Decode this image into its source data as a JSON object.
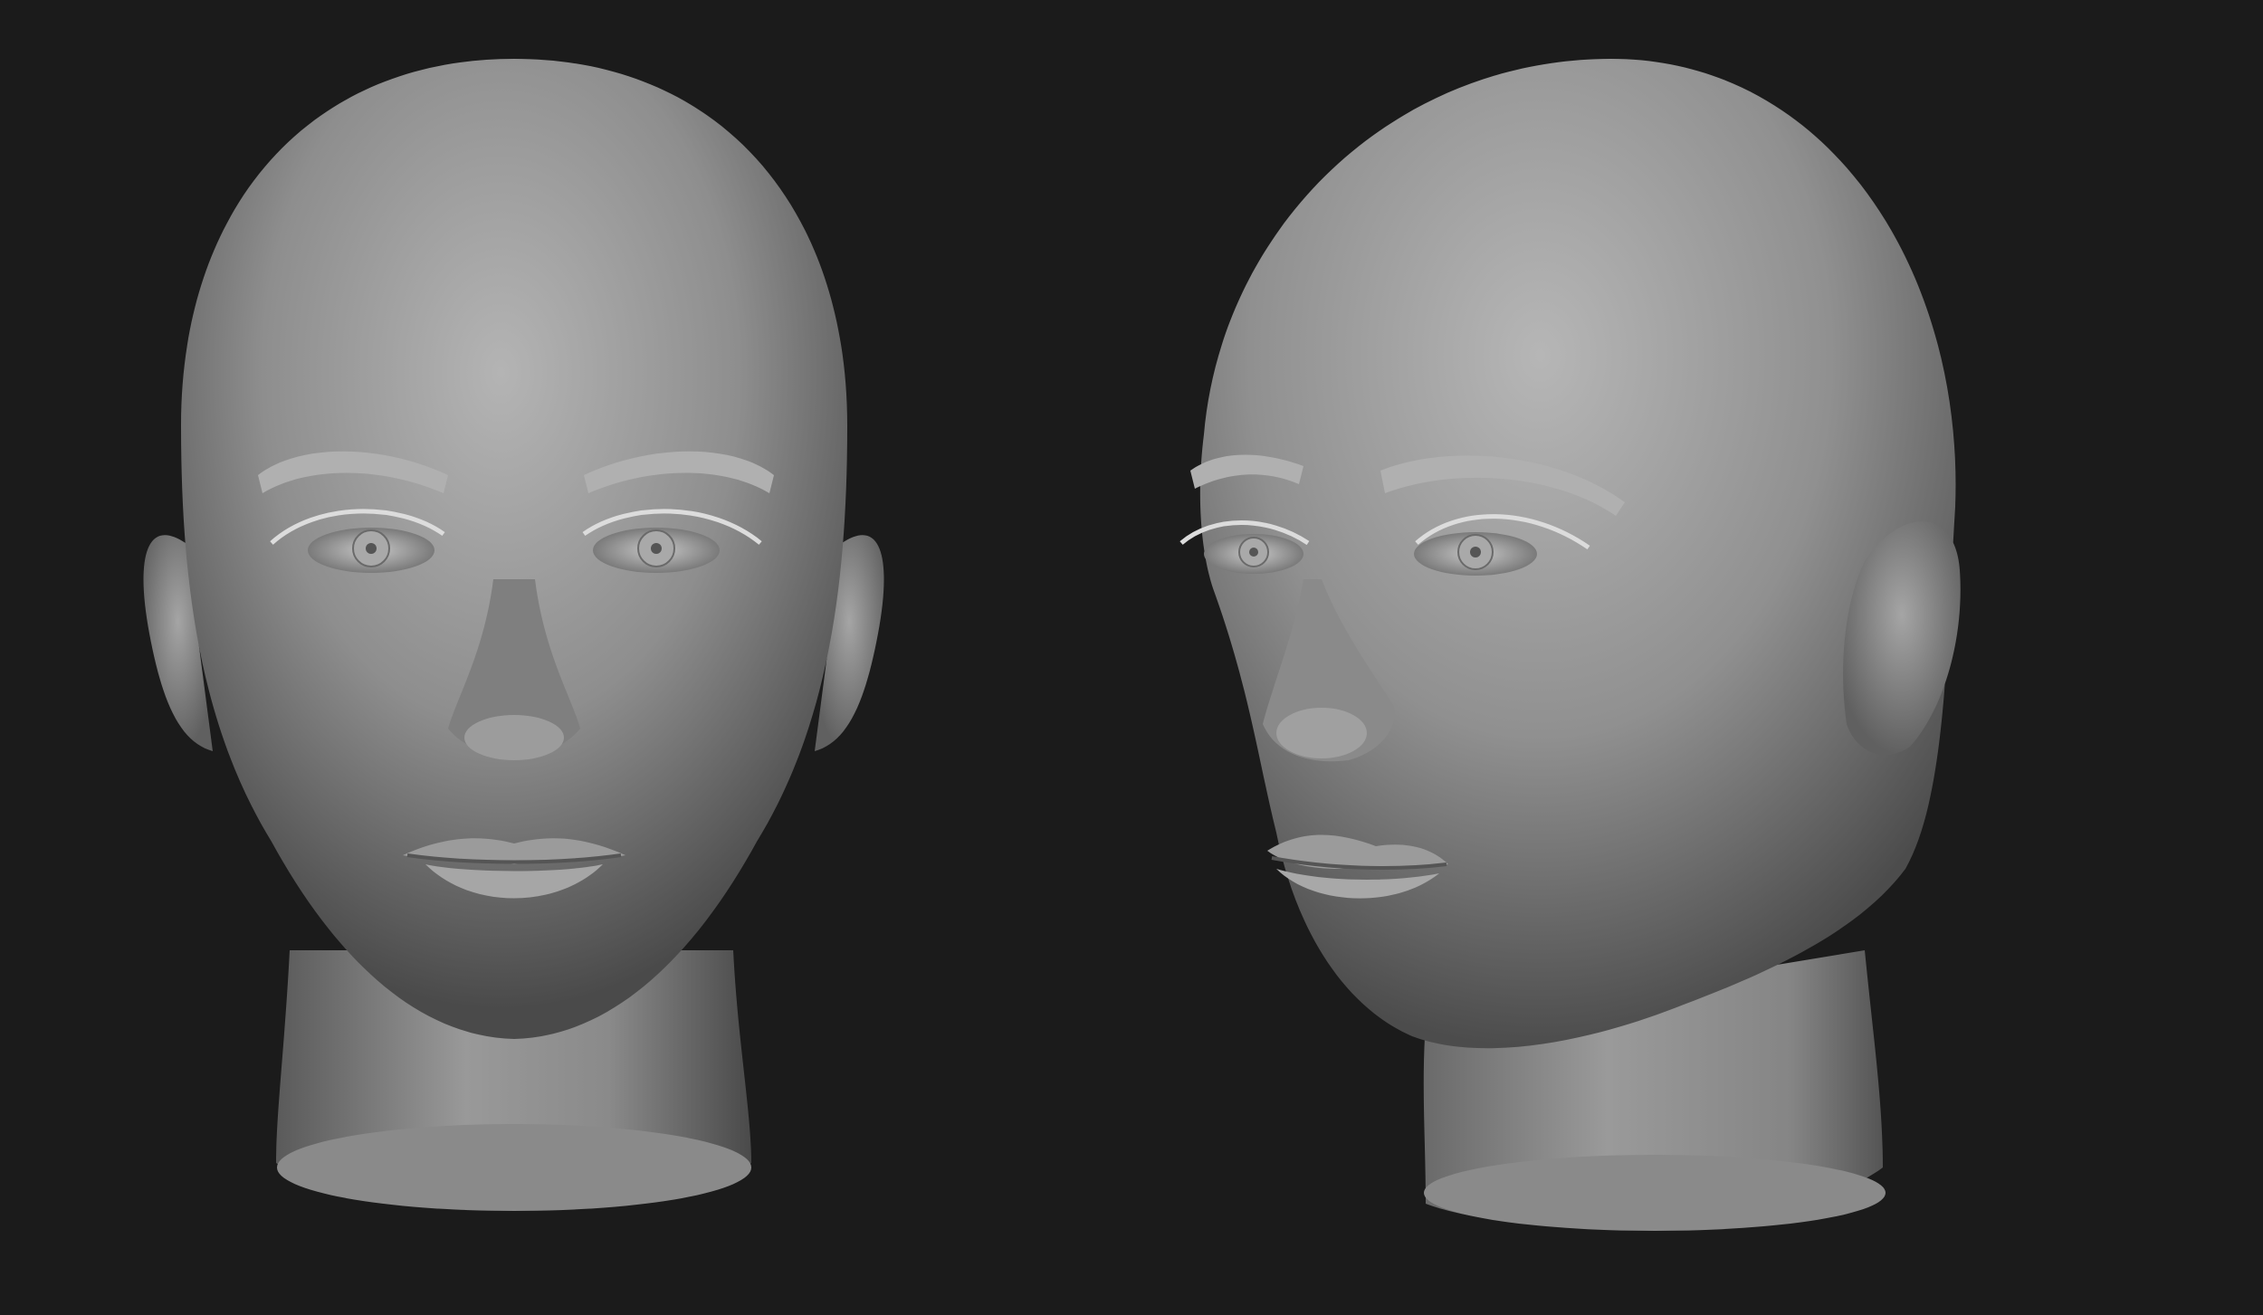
{
  "scene": {
    "background_color": "#1b1b1b",
    "material_color": "#8c8c8c",
    "views": [
      {
        "id": "front-view",
        "description_icon": "head-front-icon"
      },
      {
        "id": "three-quarter-view",
        "description_icon": "head-three-quarter-icon"
      }
    ]
  }
}
